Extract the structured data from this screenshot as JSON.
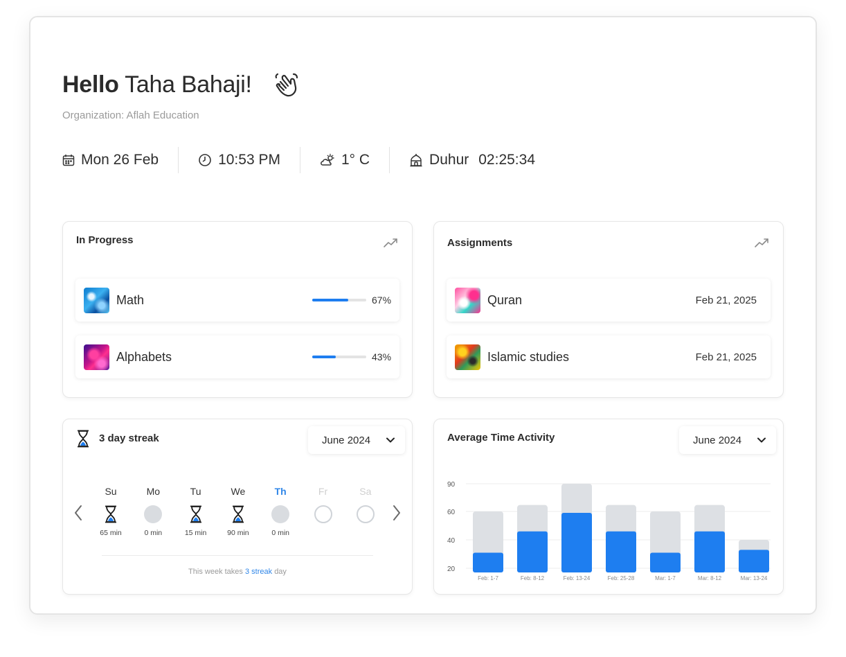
{
  "greeting": {
    "hello": "Hello",
    "name": "Taha Bahaji!",
    "organization": "Organization: Aflah Education"
  },
  "infobar": {
    "date": "Mon 26 Feb",
    "time": "10:53 PM",
    "weather": "1° C",
    "prayer_name": "Duhur",
    "prayer_countdown": "02:25:34"
  },
  "in_progress": {
    "title": "In Progress",
    "items": [
      {
        "label": "Math",
        "percent_text": "67%",
        "progress": 0.67
      },
      {
        "label": "Alphabets",
        "percent_text": "43%",
        "progress": 0.43
      }
    ]
  },
  "assignments": {
    "title": "Assignments",
    "items": [
      {
        "label": "Quran",
        "date": "Feb 21, 2025"
      },
      {
        "label": "Islamic studies",
        "date": "Feb 21, 2025"
      }
    ]
  },
  "streak": {
    "title": "3 day streak",
    "month": "June 2024",
    "days": [
      {
        "name": "Su",
        "minutes": "65 min",
        "state": "done"
      },
      {
        "name": "Mo",
        "minutes": "0 min",
        "state": "missed"
      },
      {
        "name": "Tu",
        "minutes": "15 min",
        "state": "done"
      },
      {
        "name": "We",
        "minutes": "90 min",
        "state": "done"
      },
      {
        "name": "Th",
        "minutes": "0 min",
        "state": "today"
      },
      {
        "name": "Fr",
        "minutes": "",
        "state": "future"
      },
      {
        "name": "Sa",
        "minutes": "",
        "state": "future"
      }
    ],
    "note_prefix": "This week takes",
    "note_highlight": "3 streak",
    "note_suffix": "day"
  },
  "activity": {
    "title": "Average Time Activity",
    "month": "June 2024"
  },
  "chart_data": {
    "type": "bar",
    "stacked": true,
    "categories": [
      "Feb: 1-7",
      "Feb: 8-12",
      "Feb: 13-24",
      "Feb: 25-28",
      "Mar: 1-7",
      "Mar: 8-12",
      "Mar: 13-24"
    ],
    "series": [
      {
        "values": [
          31,
          46,
          59,
          46,
          31,
          46,
          33
        ],
        "color": "#1e7ef0"
      },
      {
        "values": [
          60,
          67,
          90,
          67,
          60,
          67,
          40
        ],
        "color": "#dde0e4"
      }
    ],
    "yticks": [
      20,
      40,
      60,
      90
    ],
    "ylim": [
      20,
      90
    ],
    "grid": true
  },
  "colors": {
    "accent": "#1e7ef0",
    "highlight": "#2f86e8"
  }
}
